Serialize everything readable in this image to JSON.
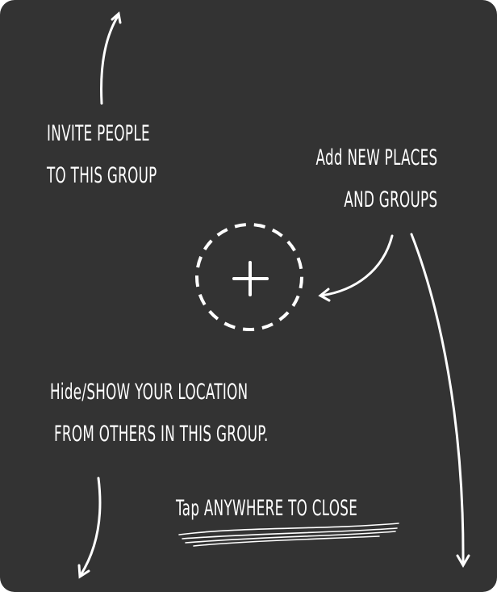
{
  "colors": {
    "overlay_background": "#333333",
    "ink": "#ffffff"
  },
  "hints": {
    "invite": {
      "line1": "INVITE PEOPLE",
      "line2": "TO THIS GROUP"
    },
    "add": {
      "line1": "Add NEW PLACES",
      "line2": "AND GROUPS"
    },
    "hide": {
      "line1": "Hide/SHOW YOUR LOCATION",
      "line2": "FROM OTHERS IN THIS GROUP."
    },
    "close": "Tap ANYWHERE TO CLOSE"
  },
  "icons": {
    "add_button": "plus-icon"
  }
}
